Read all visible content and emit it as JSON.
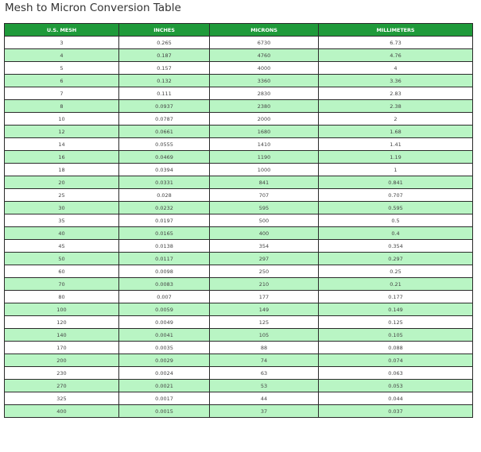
{
  "title": "Mesh to Micron Conversion Table",
  "table": {
    "headers": [
      "U.S. MESH",
      "INCHES",
      "MICRONS",
      "MILLIMETERS"
    ],
    "rows": [
      [
        "3",
        "0.265",
        "6730",
        "6.73"
      ],
      [
        "4",
        "0.187",
        "4760",
        "4.76"
      ],
      [
        "5",
        "0.157",
        "4000",
        "4"
      ],
      [
        "6",
        "0.132",
        "3360",
        "3.36"
      ],
      [
        "7",
        "0.111",
        "2830",
        "2.83"
      ],
      [
        "8",
        "0.0937",
        "2380",
        "2.38"
      ],
      [
        "10",
        "0.0787",
        "2000",
        "2"
      ],
      [
        "12",
        "0.0661",
        "1680",
        "1.68"
      ],
      [
        "14",
        "0.0555",
        "1410",
        "1.41"
      ],
      [
        "16",
        "0.0469",
        "1190",
        "1.19"
      ],
      [
        "18",
        "0.0394",
        "1000",
        "1"
      ],
      [
        "20",
        "0.0331",
        "841",
        "0.841"
      ],
      [
        "25",
        "0.028",
        "707",
        "0.707"
      ],
      [
        "30",
        "0.0232",
        "595",
        "0.595"
      ],
      [
        "35",
        "0.0197",
        "500",
        "0.5"
      ],
      [
        "40",
        "0.0165",
        "400",
        "0.4"
      ],
      [
        "45",
        "0.0138",
        "354",
        "0.354"
      ],
      [
        "50",
        "0.0117",
        "297",
        "0.297"
      ],
      [
        "60",
        "0.0098",
        "250",
        "0.25"
      ],
      [
        "70",
        "0.0083",
        "210",
        "0.21"
      ],
      [
        "80",
        "0.007",
        "177",
        "0.177"
      ],
      [
        "100",
        "0.0059",
        "149",
        "0.149"
      ],
      [
        "120",
        "0.0049",
        "125",
        "0.125"
      ],
      [
        "140",
        "0.0041",
        "105",
        "0.105"
      ],
      [
        "170",
        "0.0035",
        "88",
        "0.088"
      ],
      [
        "200",
        "0.0029",
        "74",
        "0.074"
      ],
      [
        "230",
        "0.0024",
        "63",
        "0.063"
      ],
      [
        "270",
        "0.0021",
        "53",
        "0.053"
      ],
      [
        "325",
        "0.0017",
        "44",
        "0.044"
      ],
      [
        "400",
        "0.0015",
        "37",
        "0.037"
      ]
    ]
  },
  "colors": {
    "header_bg": "#1f9a3a",
    "header_text": "#ffffff",
    "row_alt_bg": "#b9f5c4",
    "row_bg": "#ffffff",
    "border": "#2b2b2b"
  }
}
